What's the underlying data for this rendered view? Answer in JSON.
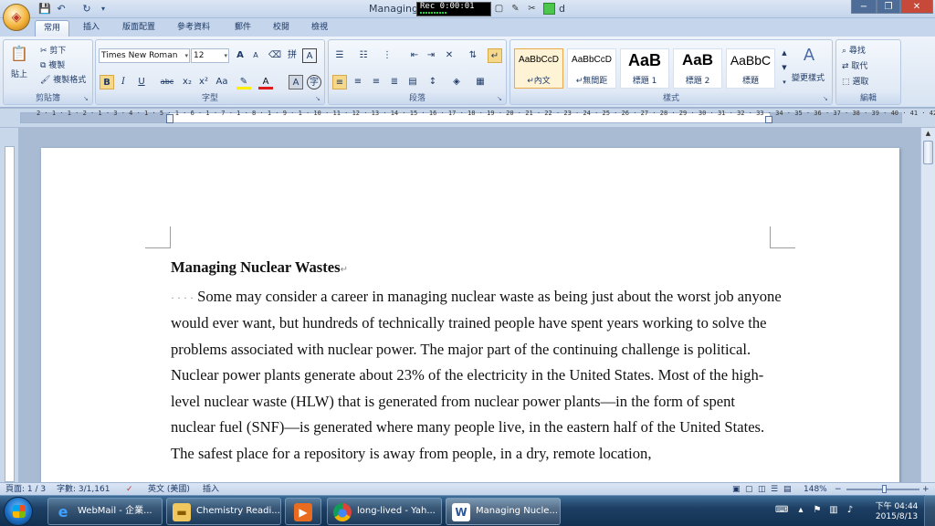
{
  "window": {
    "title": "Managing",
    "title_tail": "d",
    "minimize": "−",
    "restore": "❐",
    "close": "✕"
  },
  "recorder": {
    "label": "Rec 0:00:01"
  },
  "tabs": [
    {
      "label": "常用",
      "active": true
    },
    {
      "label": "插入"
    },
    {
      "label": "版面配置"
    },
    {
      "label": "參考資料"
    },
    {
      "label": "郵件"
    },
    {
      "label": "校閱"
    },
    {
      "label": "檢視"
    }
  ],
  "clipboard": {
    "paste": "貼上",
    "cut": "剪下",
    "copy": "複製",
    "format_painter": "複製格式",
    "label": "剪貼簿"
  },
  "font": {
    "name": "Times New Roman",
    "size": "12",
    "label": "字型",
    "bold": "B",
    "italic": "I",
    "underline": "U",
    "strike": "abc",
    "sub": "x₂",
    "sup": "x²",
    "grow": "A",
    "shrink": "A",
    "clear": "A",
    "color_a": "A",
    "char_a": "A"
  },
  "paragraph": {
    "label": "段落"
  },
  "styles": {
    "label": "樣式",
    "items": [
      {
        "preview": "AaBbCcD",
        "name": "↵內文"
      },
      {
        "preview": "AaBbCcD",
        "name": "↵無間距"
      },
      {
        "preview": "AaB",
        "name": "標題 1"
      },
      {
        "preview": "AaB",
        "name": "標題 2"
      },
      {
        "preview": "AaBbC",
        "name": "標題"
      }
    ],
    "change": "變更樣式"
  },
  "editing": {
    "label": "編輯",
    "find": "尋找",
    "replace": "取代",
    "select": "選取"
  },
  "ruler": {
    "numbers": "2 · 1 · 1 · 2 · 1 · 3 · 4 · 1 · 5 · 1 · 6 · 1 · 7 · 1 · 8 · 1 · 9 · 1 · 10 · 11 · 12 · 13 · 14 · 15 · 16 · 17 · 18 · 19 · 20 · 21 · 22 · 23 · 24 · 25 · 26 · 27 · 28 · 29 · 30 · 31 · 32 · 33 · 34 · 35 · 36 · 37 · 38 · 39 · 40 · 41 · 42",
    "tab_selector": "L"
  },
  "document": {
    "title": "Managing Nuclear Wastes",
    "paragraph_mark": "↵",
    "indent_dots": "· · · ·",
    "body": "Some may consider a career in managing nuclear waste as being just about the worst job anyone would ever want, but hundreds of technically trained people have spent years working to solve the problems associated with nuclear power. The major part of the continuing challenge is political. Nuclear power plants generate about 23% of the electricity in the United States. Most of the high-level nuclear waste (HLW) that is generated from nuclear power plants—in the form of spent nuclear fuel (SNF)—is generated where many people live, in the eastern half of the United States. The safest place for a repository is away from people, in a dry, remote location,"
  },
  "status": {
    "page": "頁面: 1 / 3",
    "words": "字數: 3/1,161",
    "language": "英文 (美國)",
    "mode": "插入",
    "zoom": "148%",
    "zoom_out": "−",
    "zoom_in": "+"
  },
  "taskbar": {
    "items": [
      {
        "label": "WebMail - 企業...",
        "icon": "ie-icon"
      },
      {
        "label": "Chemistry Readi...",
        "icon": "folder-icon"
      },
      {
        "label": "",
        "icon": "media-player-icon"
      },
      {
        "label": "long-lived - Yah...",
        "icon": "chrome-icon"
      },
      {
        "label": "Managing Nucle...",
        "icon": "word-icon"
      }
    ],
    "time": "下午 04:44",
    "date": "2015/8/13"
  }
}
